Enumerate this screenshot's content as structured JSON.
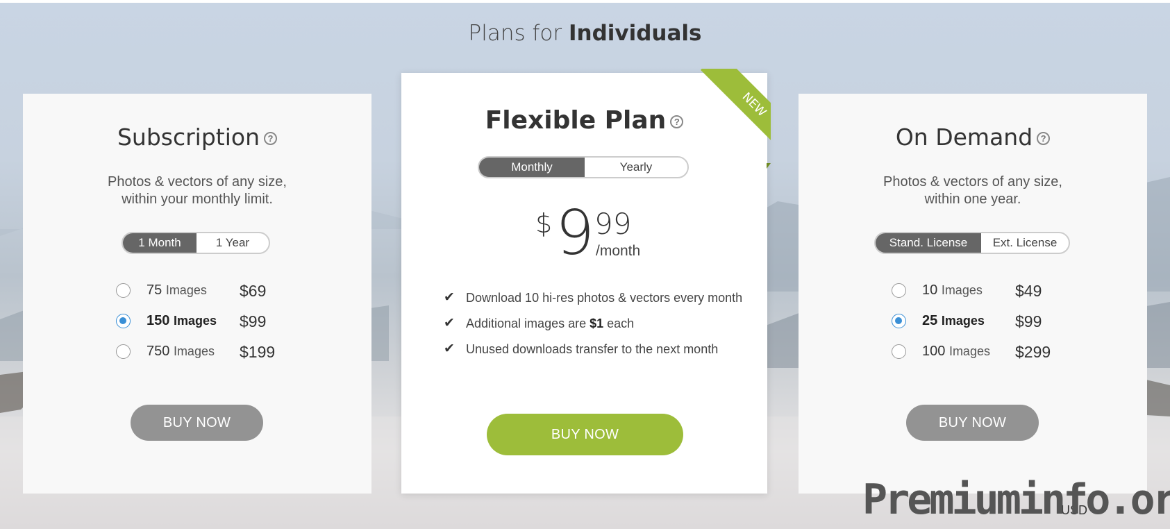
{
  "page": {
    "title_prefix": "Plans for",
    "title_bold": "Individuals"
  },
  "subscription": {
    "title": "Subscription",
    "help_icon": "?",
    "desc_line1": "Photos & vectors of any size,",
    "desc_line2": "within your monthly limit.",
    "toggle": [
      "1 Month",
      "1 Year"
    ],
    "toggle_selected": "1 Month",
    "options": [
      {
        "qty": "75",
        "unit": "Images",
        "price": "$69",
        "selected": false
      },
      {
        "qty": "150",
        "unit": "Images",
        "price": "$99",
        "selected": true
      },
      {
        "qty": "750",
        "unit": "Images",
        "price": "$199",
        "selected": false
      }
    ],
    "buy_label": "BUY NOW"
  },
  "flexible": {
    "title": "Flexible Plan",
    "help_icon": "?",
    "ribbon": "NEW",
    "toggle": [
      "Monthly",
      "Yearly"
    ],
    "toggle_selected": "Monthly",
    "price_currency": "$",
    "price_whole": "9",
    "price_cents": "99",
    "price_period": "/month",
    "features": [
      {
        "text": "Download 10 hi-res photos & vectors every month"
      },
      {
        "pre": "Additional images are ",
        "bold": "$1",
        "post": " each"
      },
      {
        "text": "Unused downloads transfer to the next month"
      }
    ],
    "buy_label": "BUY NOW"
  },
  "on_demand": {
    "title": "On Demand",
    "help_icon": "?",
    "desc_line1": "Photos & vectors of any size,",
    "desc_line2": "within one year.",
    "toggle": [
      "Stand. License",
      "Ext. License"
    ],
    "toggle_selected": "Stand. License",
    "options": [
      {
        "qty": "10",
        "unit": "Images",
        "price": "$49",
        "selected": false
      },
      {
        "qty": "25",
        "unit": "Images",
        "price": "$99",
        "selected": true
      },
      {
        "qty": "100",
        "unit": "Images",
        "price": "$299",
        "selected": false
      }
    ],
    "buy_label": "BUY NOW"
  },
  "watermark": "Premiuminfo.org",
  "currency_selector": "USD",
  "colors": {
    "accent_green": "#9dbd3a",
    "toggle_active": "#666666",
    "buy_gray": "#939393",
    "radio_blue": "#3a8fd6"
  }
}
